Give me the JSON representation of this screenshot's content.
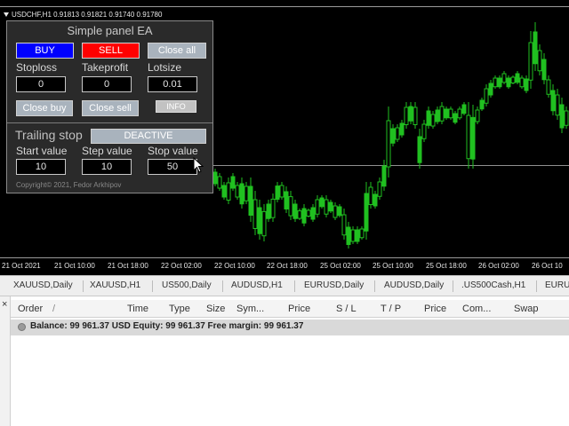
{
  "chart": {
    "title": "USDCHF,H1  0.91813 0.91821 0.91740 0.91780",
    "time_labels": [
      "21 Oct 2021",
      "21 Oct 10:00",
      "21 Oct 18:00",
      "22 Oct 02:00",
      "22 Oct 10:00",
      "22 Oct 18:00",
      "25 Oct 02:00",
      "25 Oct 10:00",
      "25 Oct 18:00",
      "26 Oct 02:00",
      "26 Oct 10"
    ],
    "candle_color": "#20c020",
    "background": "#000000"
  },
  "panel": {
    "title": "Simple panel EA",
    "buy_label": "BUY",
    "sell_label": "SELL",
    "close_all_label": "Close all",
    "stoploss_label": "Stoploss",
    "takeprofit_label": "Takeprofit",
    "lotsize_label": "Lotsize",
    "stoploss_value": "0",
    "takeprofit_value": "0",
    "lotsize_value": "0.01",
    "close_buy_label": "Close buy",
    "close_sell_label": "Close sell",
    "info_label": "INFO",
    "trailing_label": "Trailing stop",
    "deactive_label": "DEACTIVE",
    "start_label": "Start value",
    "step_label": "Step value",
    "stop_label": "Stop value",
    "start_value": "10",
    "step_value": "10",
    "stop_value": "50",
    "copyright": "Copyright© 2021, Fedor Arkhipov",
    "buy_color": "#0000ff",
    "sell_color": "#ff0000"
  },
  "tabs": [
    "XAUUSD,Daily",
    "XAUUSD,H1",
    "US500,Daily",
    "AUDUSD,H1",
    "EURUSD,Daily",
    "AUDUSD,Daily",
    ".US500Cash,H1",
    "EURU"
  ],
  "terminal": {
    "close_icon": "×",
    "columns": [
      "Order",
      "/",
      "Time",
      "Type",
      "Size",
      "Sym...",
      "Price",
      "S / L",
      "T / P",
      "Price",
      "Com...",
      "Swap"
    ],
    "balance_text": "Balance: 99 961.37 USD  Equity: 99 961.37  Free margin: 99 961.37"
  }
}
